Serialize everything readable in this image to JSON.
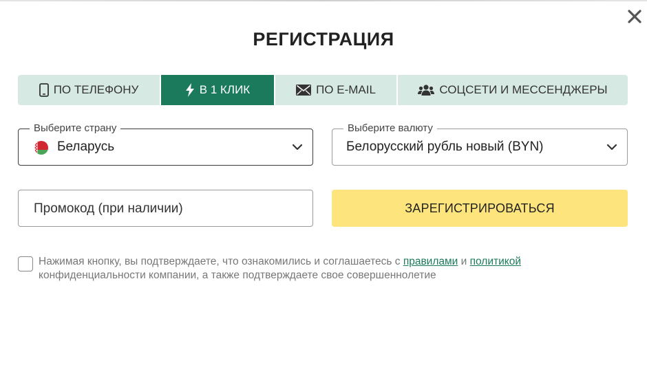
{
  "modal": {
    "title": "РЕГИСТРАЦИЯ"
  },
  "tabs": [
    {
      "label": "ПО ТЕЛЕФОНУ",
      "icon": "phone-icon",
      "active": false
    },
    {
      "label": "В 1 КЛИК",
      "icon": "lightning-icon",
      "active": true
    },
    {
      "label": "ПО E-MAIL",
      "icon": "envelope-icon",
      "active": false
    },
    {
      "label": "СОЦСЕТИ И МЕССЕНДЖЕРЫ",
      "icon": "users-icon",
      "active": false
    }
  ],
  "country": {
    "label": "Выберите страну",
    "value": "Беларусь",
    "flag_icon": "belarus-flag-icon"
  },
  "currency": {
    "label": "Выберите валюту",
    "value": "Белорусский рубль новый (BYN)"
  },
  "promo": {
    "placeholder": "Промокод (при наличии)"
  },
  "register_button": {
    "label": "ЗАРЕГИСТРИРОВАТЬСЯ"
  },
  "consent": {
    "text_before": "Нажимая кнопку, вы подтверждаете, что ознакомились и соглашаетесь с ",
    "link_rules": "правилами",
    "text_and": " и ",
    "link_policy": "политикой",
    "text_after": " конфиденциальности компании, а также подтверждаете свое совершеннолетие",
    "checked": false
  },
  "colors": {
    "accent_green": "#1b7a5c",
    "tab_background": "#d7e9e3",
    "register_yellow": "#fde47c"
  }
}
